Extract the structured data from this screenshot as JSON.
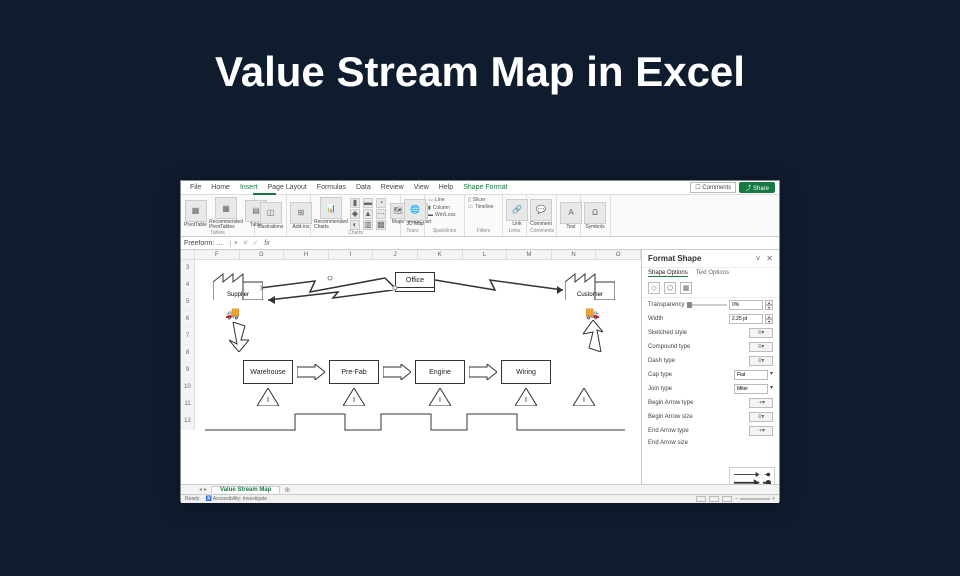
{
  "slide_title": "Value Stream Map in Excel",
  "menu": {
    "tabs": [
      "File",
      "Home",
      "Insert",
      "Page Layout",
      "Formulas",
      "Data",
      "Review",
      "View",
      "Help",
      "Shape Format"
    ],
    "active": "Insert",
    "comments": "Comments",
    "share": "Share"
  },
  "ribbon_groups": {
    "tables": "Tables",
    "pivottable": "PivotTable",
    "recpivot": "Recommended PivotTables",
    "table": "Table",
    "illustrations": "Illustrations",
    "addins": "Add-ins",
    "recchart": "Recommended Charts",
    "charts": "Charts",
    "maps": "Maps",
    "pivotchart": "PivotChart",
    "tours": "Tours",
    "map3d": "3D Map",
    "sparklines": "Sparklines",
    "sp_line": "Line",
    "sp_col": "Column",
    "sp_wl": "Win/Loss",
    "filters": "Filters",
    "slicer": "Slicer",
    "timeline": "Timeline",
    "links": "Links",
    "link": "Link",
    "comments_grp": "Comments",
    "comment": "Comment",
    "text": "Text",
    "symbols": "Symbols"
  },
  "formula_bar": {
    "namebox": "Freeform: …",
    "fx": "fx"
  },
  "columns": [
    "F",
    "G",
    "H",
    "I",
    "J",
    "K",
    "L",
    "M",
    "N",
    "O"
  ],
  "rows": [
    "3",
    "4",
    "5",
    "6",
    "7",
    "8",
    "9",
    "10",
    "11",
    "12"
  ],
  "shapes": {
    "supplier": "Supplier",
    "office": "Office",
    "customer": "Customer",
    "warehouse": "Warehouse",
    "prefab": "Pre-Fab",
    "engine": "Engine",
    "wiring": "Wiring",
    "I": "I"
  },
  "panel": {
    "title": "Format Shape",
    "tab_shape": "Shape Options",
    "tab_text": "Text Options",
    "transparency": "Transparency",
    "transparency_val": "0%",
    "width": "Width",
    "width_val": "2.25 pt",
    "sketched": "Sketched style",
    "compound": "Compound type",
    "dash": "Dash type",
    "cap": "Cap type",
    "cap_val": "Flat",
    "join": "Join type",
    "join_val": "Miter",
    "begin_type": "Begin Arrow type",
    "begin_size": "Begin Arrow size",
    "end_type": "End Arrow type",
    "end_size": "End Arrow size"
  },
  "sheet_tab": "Value Stream Map",
  "status": {
    "ready": "Ready",
    "access": "Accessibility: Investigate"
  }
}
